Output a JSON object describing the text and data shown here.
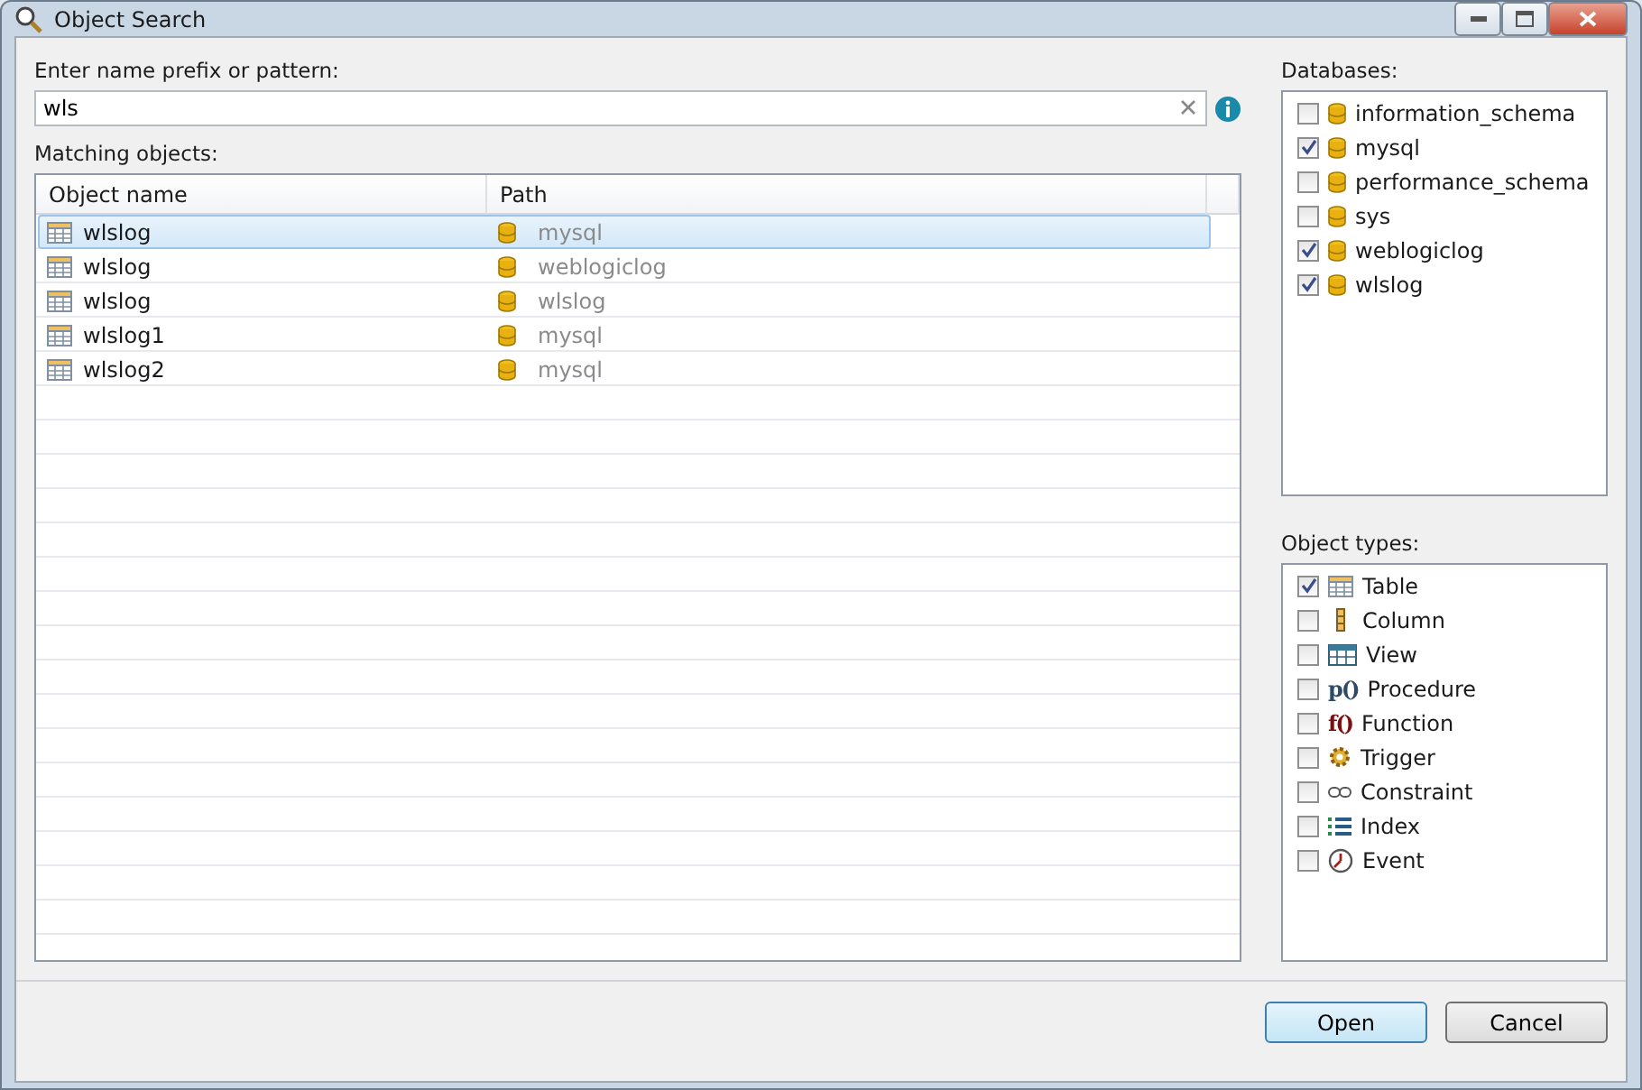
{
  "window": {
    "title": "Object Search"
  },
  "search": {
    "label": "Enter name prefix or pattern:",
    "value": "wls"
  },
  "results": {
    "label": "Matching objects:",
    "columns": [
      "Object name",
      "Path"
    ],
    "rows": [
      {
        "name": "wlslog",
        "path": "mysql",
        "selected": true
      },
      {
        "name": "wlslog",
        "path": "weblogiclog",
        "selected": false
      },
      {
        "name": "wlslog",
        "path": "wlslog",
        "selected": false
      },
      {
        "name": "wlslog1",
        "path": "mysql",
        "selected": false
      },
      {
        "name": "wlslog2",
        "path": "mysql",
        "selected": false
      }
    ]
  },
  "databases": {
    "label": "Databases:",
    "items": [
      {
        "name": "information_schema",
        "checked": false
      },
      {
        "name": "mysql",
        "checked": true
      },
      {
        "name": "performance_schema",
        "checked": false
      },
      {
        "name": "sys",
        "checked": false
      },
      {
        "name": "weblogiclog",
        "checked": true
      },
      {
        "name": "wlslog",
        "checked": true
      }
    ]
  },
  "object_types": {
    "label": "Object types:",
    "items": [
      {
        "name": "Table",
        "kind": "table",
        "checked": true
      },
      {
        "name": "Column",
        "kind": "column",
        "checked": false
      },
      {
        "name": "View",
        "kind": "view",
        "checked": false
      },
      {
        "name": "Procedure",
        "kind": "procedure",
        "glyph": "p()",
        "checked": false
      },
      {
        "name": "Function",
        "kind": "function",
        "glyph": "f()",
        "checked": false
      },
      {
        "name": "Trigger",
        "kind": "trigger",
        "checked": false
      },
      {
        "name": "Constraint",
        "kind": "constraint",
        "checked": false
      },
      {
        "name": "Index",
        "kind": "index",
        "checked": false
      },
      {
        "name": "Event",
        "kind": "event",
        "checked": false
      }
    ]
  },
  "buttons": [
    {
      "label": "Open",
      "default": true
    },
    {
      "label": "Cancel",
      "default": false
    }
  ]
}
